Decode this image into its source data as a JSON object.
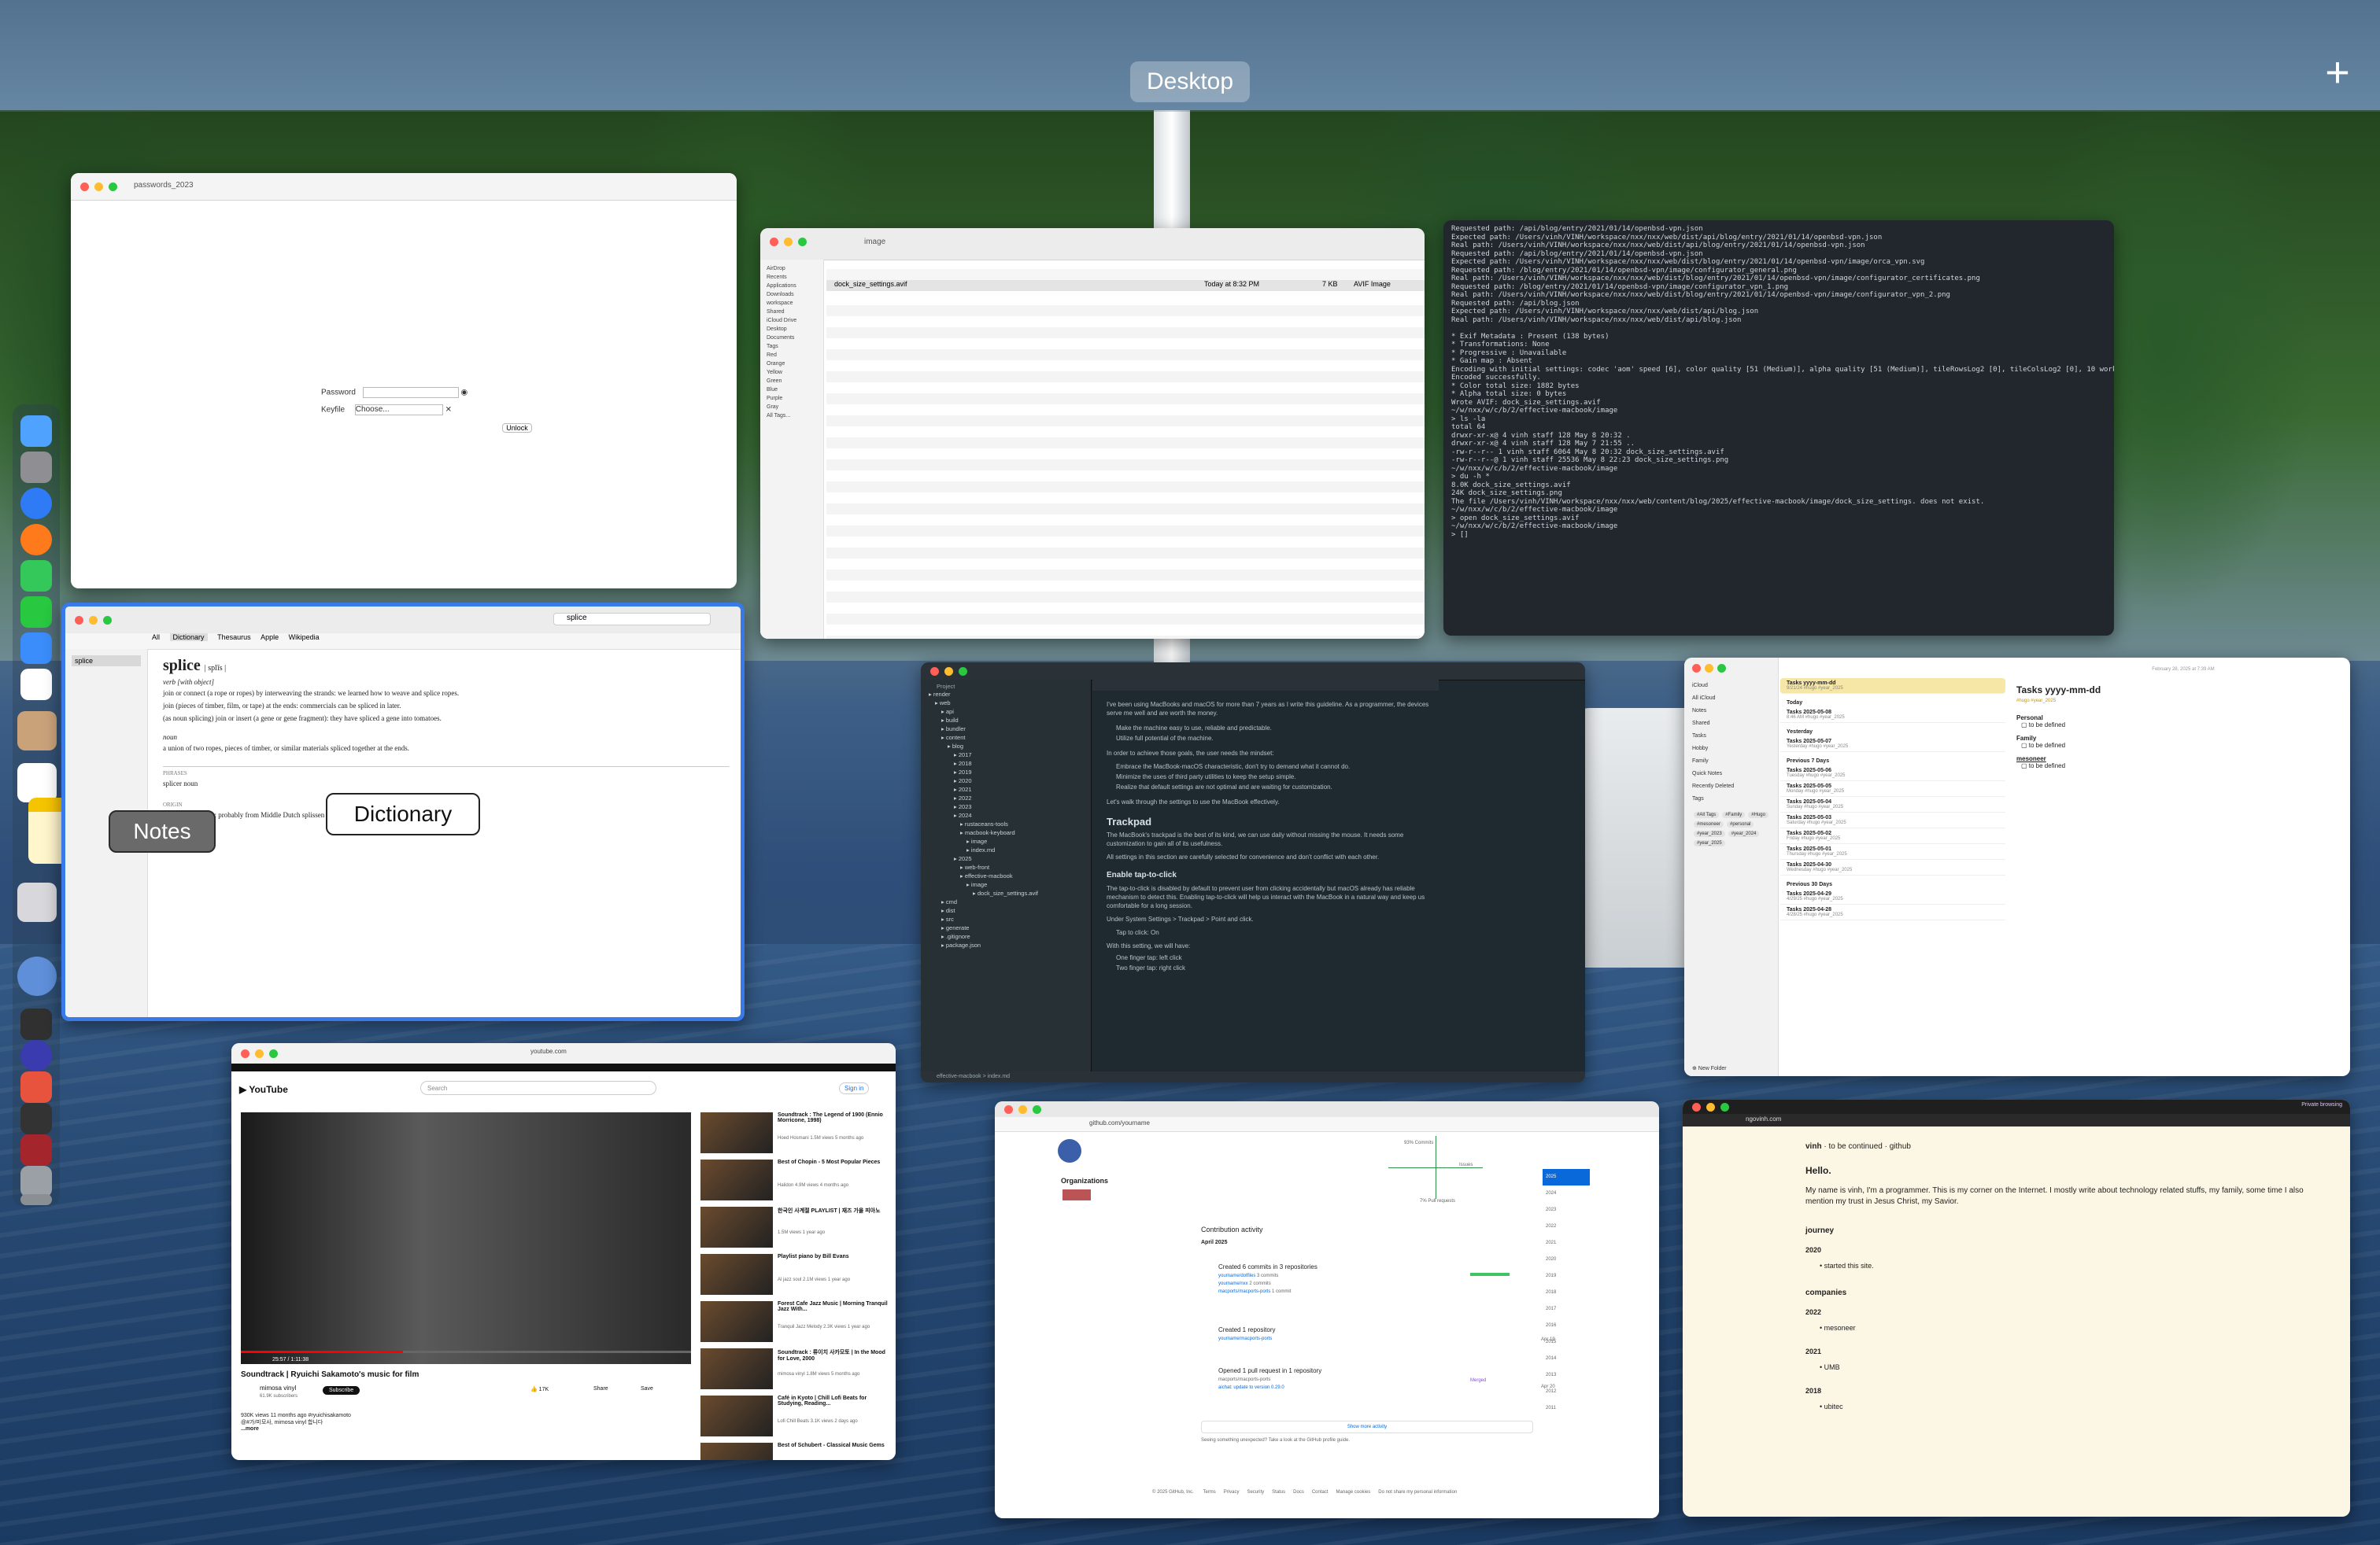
{
  "spaces_bar": {
    "desktop_label": "Desktop",
    "add_label": "+"
  },
  "labels": {
    "notes": "Notes",
    "dictionary": "Dictionary"
  },
  "dictionary": {
    "search_value": "splice",
    "tabs": [
      "All",
      "Dictionary",
      "Thesaurus",
      "Apple",
      "Wikipedia"
    ],
    "headword": "splice",
    "pronunciation": "| splīs |",
    "pos_verb": "verb [with object]",
    "def1": "join or connect (a rope or ropes) by interweaving the strands: we learned how to weave and splice ropes.",
    "def2": "join (pieces of timber, film, or tape) at the ends: commercials can be spliced in later.",
    "def3": "(as noun splicing) join or insert (a gene or gene fragment): they have spliced a gene into tomatoes.",
    "pos_noun": "noun",
    "def4": "a union of two ropes, pieces of timber, or similar materials spliced together at the ends.",
    "phrases_title": "PHRASES",
    "phrase": "splicer  noun",
    "origin_title": "ORIGIN",
    "origin": "early 16th century: probably from Middle Dutch splissen"
  },
  "passwords": {
    "title": "passwords_2023",
    "field1": "Password",
    "field2": "Keyfile",
    "keyfile_value": "Choose...",
    "unlock": "Unlock"
  },
  "finder": {
    "title": "image",
    "file": "dock_size_settings.avif",
    "date": "Today at 8:32 PM",
    "size": "7 KB",
    "kind": "AVIF Image",
    "sidebar": [
      "AirDrop",
      "Recents",
      "Applications",
      "Downloads",
      "workspace",
      "Shared",
      "iCloud Drive",
      "Desktop",
      "Documents",
      "Tags",
      "Red",
      "Orange",
      "Yellow",
      "Green",
      "Blue",
      "Purple",
      "Gray",
      "All Tags..."
    ]
  },
  "terminal": {
    "lines": [
      "Requested path: /api/blog/entry/2021/01/14/openbsd-vpn.json",
      "Expected path: /Users/vinh/VINH/workspace/nxx/nxx/web/dist/api/blog/entry/2021/01/14/openbsd-vpn.json",
      "Real path: /Users/vinh/VINH/workspace/nxx/nxx/web/dist/api/blog/entry/2021/01/14/openbsd-vpn.json",
      "Requested path: /api/blog/entry/2021/01/14/openbsd-vpn.json",
      "Expected path: /Users/vinh/VINH/workspace/nxx/nxx/web/dist/blog/entry/2021/01/14/openbsd-vpn/image/orca_vpn.svg",
      "Requested path: /blog/entry/2021/01/14/openbsd-vpn/image/configurator_general.png",
      "Real path: /Users/vinh/VINH/workspace/nxx/nxx/web/dist/blog/entry/2021/01/14/openbsd-vpn/image/configurator_certificates.png",
      "Requested path: /blog/entry/2021/01/14/openbsd-vpn/image/configurator_vpn_1.png",
      "Real path: /Users/vinh/VINH/workspace/nxx/nxx/web/dist/blog/entry/2021/01/14/openbsd-vpn/image/configurator_vpn_2.png",
      "Requested path: /api/blog.json",
      "Expected path: /Users/vinh/VINH/workspace/nxx/nxx/web/dist/api/blog.json",
      "Real path: /Users/vinh/VINH/workspace/nxx/nxx/web/dist/api/blog.json",
      "",
      "* Exif Metadata  : Present (138 bytes)",
      "* Transformations: None",
      "* Progressive    : Unavailable",
      "* Gain map       : Absent",
      "Encoding with initial settings: codec 'aom' speed [6], color quality [51 (Medium)], alpha quality [51 (Medium)], tileRowsLog2 [0], tileColsLog2 [0], 10 worker thread(s), please wait...",
      "Encoded successfully.",
      " * Color total size: 1882 bytes",
      " * Alpha total size: 0 bytes",
      "Wrote AVIF: dock_size_settings.avif",
      "~/w/nxx/w/c/b/2/effective-macbook/image",
      "> ls -la",
      "total 64",
      "drwxr-xr-x@ 4 vinh  staff   128 May  8 20:32 .",
      "drwxr-xr-x@ 4 vinh  staff   128 May  7 21:55 ..",
      "-rw-r--r--  1 vinh  staff  6064 May  8 20:32 dock_size_settings.avif",
      "-rw-r--r--@ 1 vinh  staff 25536 May  8 22:23 dock_size_settings.png",
      "~/w/nxx/w/c/b/2/effective-macbook/image",
      "> du -h *",
      "8.0K    dock_size_settings.avif",
      " 24K    dock_size_settings.png",
      "The file /Users/vinh/VINH/workspace/nxx/nxx/web/content/blog/2025/effective-macbook/image/dock_size_settings. does not exist.",
      "~/w/nxx/w/c/b/2/effective-macbook/image",
      "> open dock_size_settings.avif",
      "~/w/nxx/w/c/b/2/effective-macbook/image",
      "> []"
    ]
  },
  "editor": {
    "project_label": "Project",
    "tree": [
      "render",
      "web",
      "api",
      "build",
      "bundler",
      "content",
      "blog",
      "2017",
      "2018",
      "2019",
      "2020",
      "2021",
      "2022",
      "2023",
      "2024",
      "rustaceans-tools",
      "macbook-keyboard",
      "image",
      "index.md",
      "2025",
      "web-front",
      "effective-macbook",
      "image",
      "dock_size_settings.avif",
      "cmd",
      "dist",
      "src",
      "generate",
      ".gitignore",
      "package.json"
    ],
    "intro": "I've been using MacBooks and macOS for more than 7 years as I write this guideline. As a programmer, the devices serve me well and are worth the money.",
    "bullet1": "Make the machine easy to use, reliable and predictable.",
    "bullet2": "Utilize full potential of the machine.",
    "mindset": "In order to achieve those goals, the user needs the mindset:",
    "bullet3": "Embrace the MacBook-macOS characteristic, don't try to demand what it cannot do.",
    "bullet4": "Minimize the uses of third party utilities to keep the setup simple.",
    "bullet5": "Realize that default settings are not optimal and are waiting for customization.",
    "walk": "Let's walk through the settings to use the MacBook effectively.",
    "h_trackpad": "Trackpad",
    "p_trackpad": "The MacBook's trackpad is the best of its kind, we can use daily without missing the mouse. It needs some customization to gain all of its usefulness.",
    "p_settings": "All settings in this section are carefully selected for convenience and don't conflict with each other.",
    "h_tap": "Enable tap-to-click",
    "p_tap": "The tap-to-click is disabled by default to prevent user from clicking accidentally but macOS already has reliable mechanism to detect this. Enabling tap-to-click will help us interact with the MacBook in a natural way and keep us comfortable for a long session.",
    "p_under": "Under System Settings > Trackpad > Point and click.",
    "bullet6": "Tap to click: On",
    "p_with": "With this setting, we will have:",
    "bullet7": "One finger tap: left click",
    "bullet8": "Two finger tap: right click",
    "status": "effective-macbook > index.md"
  },
  "notes": {
    "title": "Tasks yyyy-mm-dd",
    "folders": [
      "iCloud",
      "All iCloud",
      "Notes",
      "Shared",
      "Tasks",
      "Hobby",
      "Family",
      "Quick Notes",
      "Recently Deleted",
      "Tags"
    ],
    "tags": [
      "#All Tags",
      "#Family",
      "#Hugo",
      "#mesoneer",
      "#personal",
      "#year_2023",
      "#year_2024",
      "#year_2025"
    ],
    "list": [
      {
        "title": "Tasks yyyy-mm-dd",
        "sub": "9/21/24  #hugo #year_2025"
      },
      {
        "title": "Tasks 2025-05-08",
        "sub": "8:46 AM  #hugo #year_2025"
      },
      {
        "title": "Tasks 2025-05-07",
        "sub": "Yesterday  #hugo #year_2025"
      },
      {
        "title": "Tasks 2025-05-06",
        "sub": "Tuesday  #hugo #year_2025"
      },
      {
        "title": "Tasks 2025-05-05",
        "sub": "Monday  #hugo #year_2025"
      },
      {
        "title": "Tasks 2025-05-04",
        "sub": "Sunday  #hugo #year_2025"
      },
      {
        "title": "Tasks 2025-05-03",
        "sub": "Saturday  #hugo #year_2025"
      },
      {
        "title": "Tasks 2025-05-02",
        "sub": "Friday  #hugo #year_2025"
      },
      {
        "title": "Tasks 2025-05-01",
        "sub": "Thursday  #hugo #year_2025"
      },
      {
        "title": "Tasks 2025-04-30",
        "sub": "Wednesday  #hugo #year_2025"
      },
      {
        "title": "Tasks 2025-04-29",
        "sub": "4/29/25  #hugo #year_2025"
      },
      {
        "title": "Tasks 2025-04-28",
        "sub": "4/28/25  #hugo #year_2025"
      }
    ],
    "sections": [
      "Today",
      "Yesterday",
      "Previous 7 Days",
      "Previous 30 Days"
    ],
    "detail_date": "February 28, 2025 at 7:39 AM",
    "detail_tag": "#hugo #year_2025",
    "personal": "Personal",
    "family": "Family",
    "mesoneer": "mesoneer",
    "todo": "to be defined",
    "new_folder": "New Folder"
  },
  "youtube": {
    "url": "youtube.com",
    "search_placeholder": "Search",
    "sign_in": "Sign in",
    "video_title": "Soundtrack | Ryuichi Sakamoto's music for film",
    "channel": "mimosa vinyl",
    "subscribers": "61.9K subscribers",
    "subscribe": "Subscribe",
    "likes": "17K",
    "share": "Share",
    "save": "Save",
    "views": "930K views  11 months ago  #ryuichisakamoto",
    "desc": "@#가/미모사, mimosa vinyl  합니다",
    "more": "...more",
    "time": "25:57 / 1:11:38",
    "sidebar": [
      {
        "title": "Soundtrack : The Legend of 1900 (Ennio Morricone, 1998)",
        "meta": "Hoed Hosmani  1.5M views  5 months ago"
      },
      {
        "title": "Best of Chopin - 5 Most Popular Pieces",
        "meta": "Halidon  4.9M views  4 months ago"
      },
      {
        "title": "한국인 사계절 PLAYLIST | 재즈 가을 피아노",
        "meta": "1.5M views  1 year ago"
      },
      {
        "title": "Playlist piano by Bill Evans",
        "meta": "Al jazz soul  2.1M views  1 year ago"
      },
      {
        "title": "Forest Cafe Jazz Music | Morning Tranquil Jazz With...",
        "meta": "Tranquil Jazz Melody  2.3K views  1 year ago"
      },
      {
        "title": "Soundtrack : 류이치 사카모토 | In the Mood for Love, 2000",
        "meta": "mimosa vinyl  1.8M views  5 months ago"
      },
      {
        "title": "Café in Kyoto | Chill Lofi Beats for Studying, Reading...",
        "meta": "Lofi Chill Beats  3.1K views  2 days ago"
      },
      {
        "title": "Best of Schubert - Classical Music Gems",
        "meta": "Classical Music  8.1M views"
      }
    ]
  },
  "github": {
    "url": "github.com/yourname",
    "organizations": "Organizations",
    "contribution_activity": "Contribution activity",
    "month": "April 2025",
    "ev1": "Created 6 commits in 3 repositories",
    "ev1_r1": "yourname/dotfiles",
    "ev1_r1c": "3 commits",
    "ev1_r2": "yourname/nxx",
    "ev1_r2c": "2 commits",
    "ev1_r3": "macports/macports-ports",
    "ev1_r3c": "1 commit",
    "ev2": "Created 1 repository",
    "ev2_repo": "yourname/macports-ports",
    "ev2_date": "Apr 19",
    "ev3": "Opened 1 pull request in 1 repository",
    "ev3_repo": "macports/macports-ports",
    "ev3_pr": "aichat: update to version 0.29.0",
    "ev3_state": "Merged",
    "ev3_date": "Apr 20",
    "show_more": "Show more activity",
    "footer": "Seeing something unexpected? Take a look at the GitHub profile guide.",
    "copyright": "© 2025 GitHub, Inc.",
    "footer_links": [
      "Terms",
      "Privacy",
      "Security",
      "Status",
      "Docs",
      "Contact",
      "Manage cookies",
      "Do not share my personal information"
    ],
    "years": [
      "2025",
      "2024",
      "2023",
      "2022",
      "2021",
      "2020",
      "2019",
      "2018",
      "2017",
      "2016",
      "2015",
      "2014",
      "2013",
      "2012",
      "2011"
    ],
    "chart_top": "93% Commits",
    "chart_right": "Issues",
    "chart_bottom": "7% Pull requests"
  },
  "site": {
    "url": "ngovinh.com",
    "brand": "vinh",
    "tagline": "to be continued · github",
    "hello": "Hello.",
    "intro": "My name is vinh, I'm a programmer. This is my corner on the Internet. I mostly write about technology related stuffs, my family, some time I also mention my trust in Jesus Christ, my Savior.",
    "journey": "journey",
    "y2020": "2020",
    "started": "started this site.",
    "companies": "companies",
    "y2022": "2022",
    "c1": "mesoneer",
    "y2021": "2021",
    "c2": "UMB",
    "y2018": "2018",
    "c3": "ubitec",
    "private_browsing": "Private browsing"
  },
  "colors": {
    "accent_blue": "#2f7bf6",
    "notes_yellow": "#f5c400",
    "selection": "#3a7ae8"
  }
}
